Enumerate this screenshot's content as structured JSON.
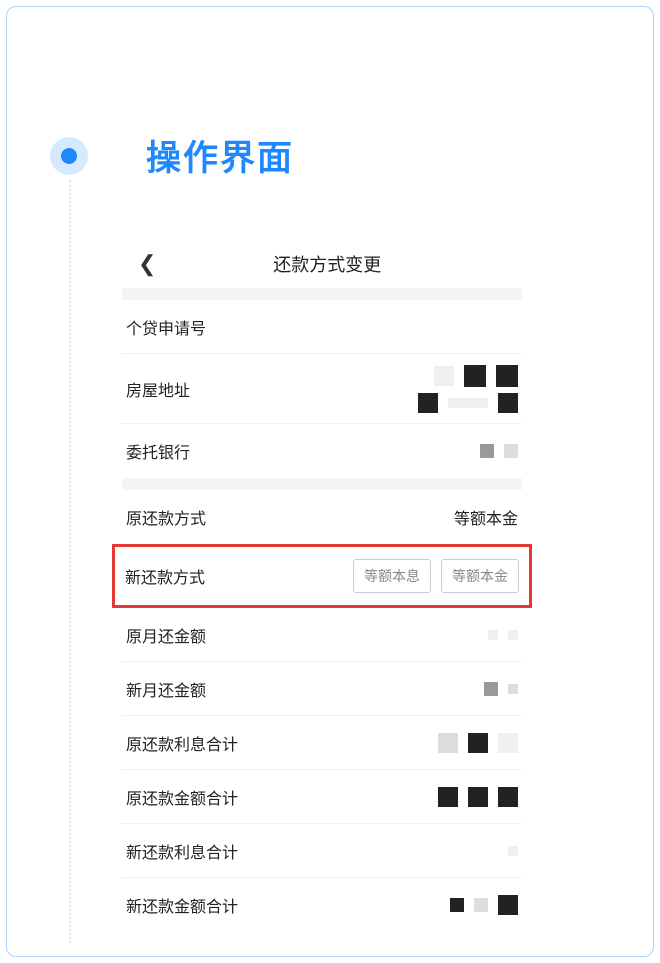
{
  "section_title": "操作界面",
  "screen": {
    "header_title": "还款方式变更",
    "rows": {
      "loan_app_label": "个贷申请号",
      "address_label": "房屋地址",
      "bank_label": "委托银行",
      "orig_method_label": "原还款方式",
      "orig_method_value": "等额本金",
      "new_method_label": "新还款方式",
      "option_a": "等额本息",
      "option_b": "等额本金",
      "orig_monthly_label": "原月还金额",
      "new_monthly_label": "新月还金额",
      "orig_interest_total_label": "原还款利息合计",
      "orig_amount_total_label": "原还款金额合计",
      "new_interest_total_label": "新还款利息合计",
      "new_amount_total_label": "新还款金额合计"
    }
  }
}
